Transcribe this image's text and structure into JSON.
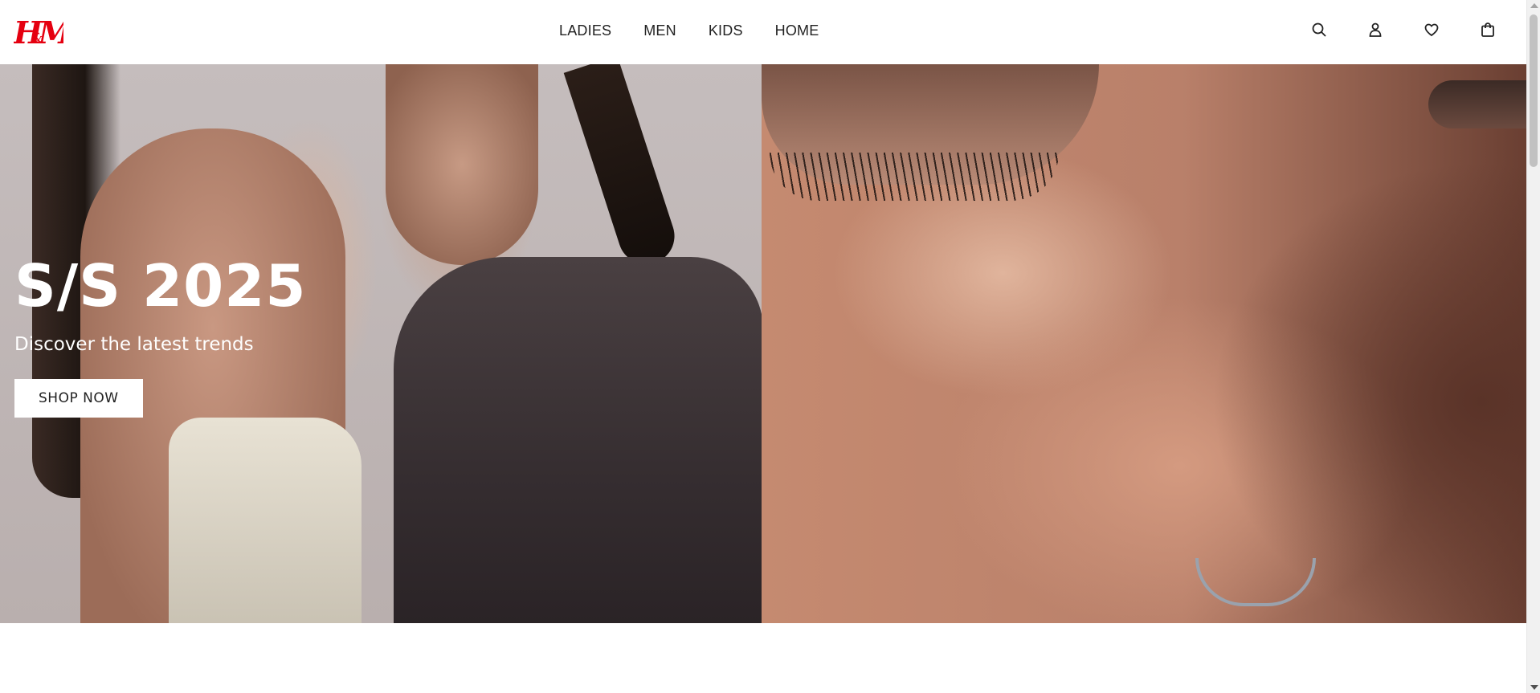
{
  "header": {
    "logo_text": "H&M",
    "brand_color": "#e50010",
    "nav": [
      {
        "label": "LADIES"
      },
      {
        "label": "MEN"
      },
      {
        "label": "KIDS"
      },
      {
        "label": "HOME"
      }
    ],
    "icons": [
      "search-icon",
      "account-icon",
      "favorites-icon",
      "shopping-bag-icon"
    ]
  },
  "hero": {
    "title": "S/S 2025",
    "subtitle": "Discover the latest trends",
    "cta_label": "SHOP NOW"
  }
}
